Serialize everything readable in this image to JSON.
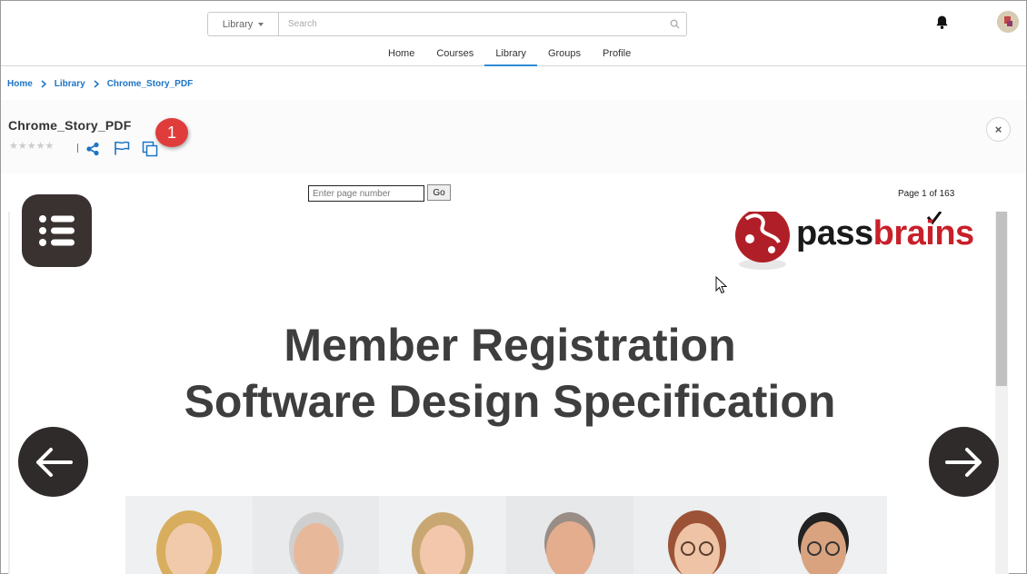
{
  "header": {
    "search_scope": "Library",
    "search_placeholder": "Search",
    "nav": [
      {
        "label": "Home"
      },
      {
        "label": "Courses"
      },
      {
        "label": "Library"
      },
      {
        "label": "Groups"
      },
      {
        "label": "Profile"
      }
    ],
    "active_nav": "Library"
  },
  "breadcrumb": [
    "Home",
    "Library",
    "Chrome_Story_PDF"
  ],
  "document": {
    "title": "Chrome_Story_PDF",
    "rating_stars": "★★★★★",
    "step_badge": "1",
    "close_symbol": "×"
  },
  "viewer": {
    "page_input_placeholder": "Enter page number",
    "go_label": "Go",
    "page_indicator": "Page 1 of 163",
    "slide": {
      "logo_text_dark": "pass",
      "logo_text_red": "brains",
      "title_line1": "Member Registration",
      "title_line2": "Software Design Specification"
    }
  },
  "colors": {
    "accent": "#2f8bd6",
    "breadcrumb": "#1d74c4",
    "badge": "#e03c3c",
    "logo_red": "#c8202a",
    "nav_buttons": "#2f2b2a"
  },
  "icons": [
    "search-icon",
    "bell-icon",
    "avatar",
    "share-icon",
    "flag-icon",
    "copy-icon",
    "close-icon",
    "menu-list-icon",
    "arrow-left-icon",
    "arrow-right-icon"
  ]
}
